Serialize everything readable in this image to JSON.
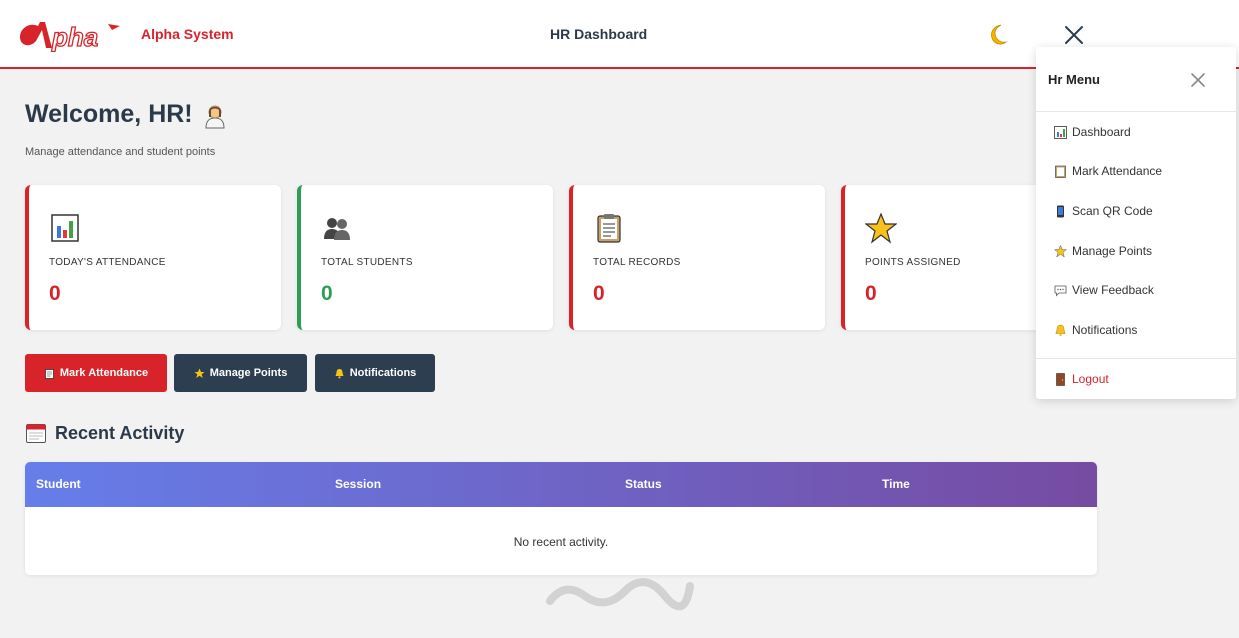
{
  "header": {
    "brand": "Alpha System",
    "title": "HR Dashboard"
  },
  "welcome": {
    "title": "Welcome, HR!",
    "subtitle": "Manage attendance and student points"
  },
  "stats": [
    {
      "label": "TODAY'S ATTENDANCE",
      "value": "0",
      "icon": "bar-chart-icon"
    },
    {
      "label": "TOTAL STUDENTS",
      "value": "0",
      "icon": "people-icon"
    },
    {
      "label": "TOTAL RECORDS",
      "value": "0",
      "icon": "clipboard-icon"
    },
    {
      "label": "POINTS ASSIGNED",
      "value": "0",
      "icon": "star-icon"
    }
  ],
  "actions": {
    "mark_attendance": "Mark Attendance",
    "manage_points": "Manage Points",
    "notifications": "Notifications"
  },
  "recent": {
    "title": "Recent Activity",
    "columns": [
      "Student",
      "Session",
      "Status",
      "Time"
    ],
    "empty": "No recent activity."
  },
  "menu": {
    "title": "Hr Menu",
    "items": [
      {
        "label": "Dashboard",
        "icon": "bar-chart-icon"
      },
      {
        "label": "Mark Attendance",
        "icon": "clipboard-icon"
      },
      {
        "label": "Scan QR Code",
        "icon": "phone-icon"
      },
      {
        "label": "Manage Points",
        "icon": "star-icon"
      },
      {
        "label": "View Feedback",
        "icon": "speech-bubble-icon"
      },
      {
        "label": "Notifications",
        "icon": "bell-icon"
      }
    ],
    "logout": "Logout"
  },
  "colors": {
    "accent": "#d9232a",
    "dark": "#2d3e50",
    "success": "#2e9e55",
    "gradient_start": "#667eea",
    "gradient_end": "#764ba2"
  }
}
